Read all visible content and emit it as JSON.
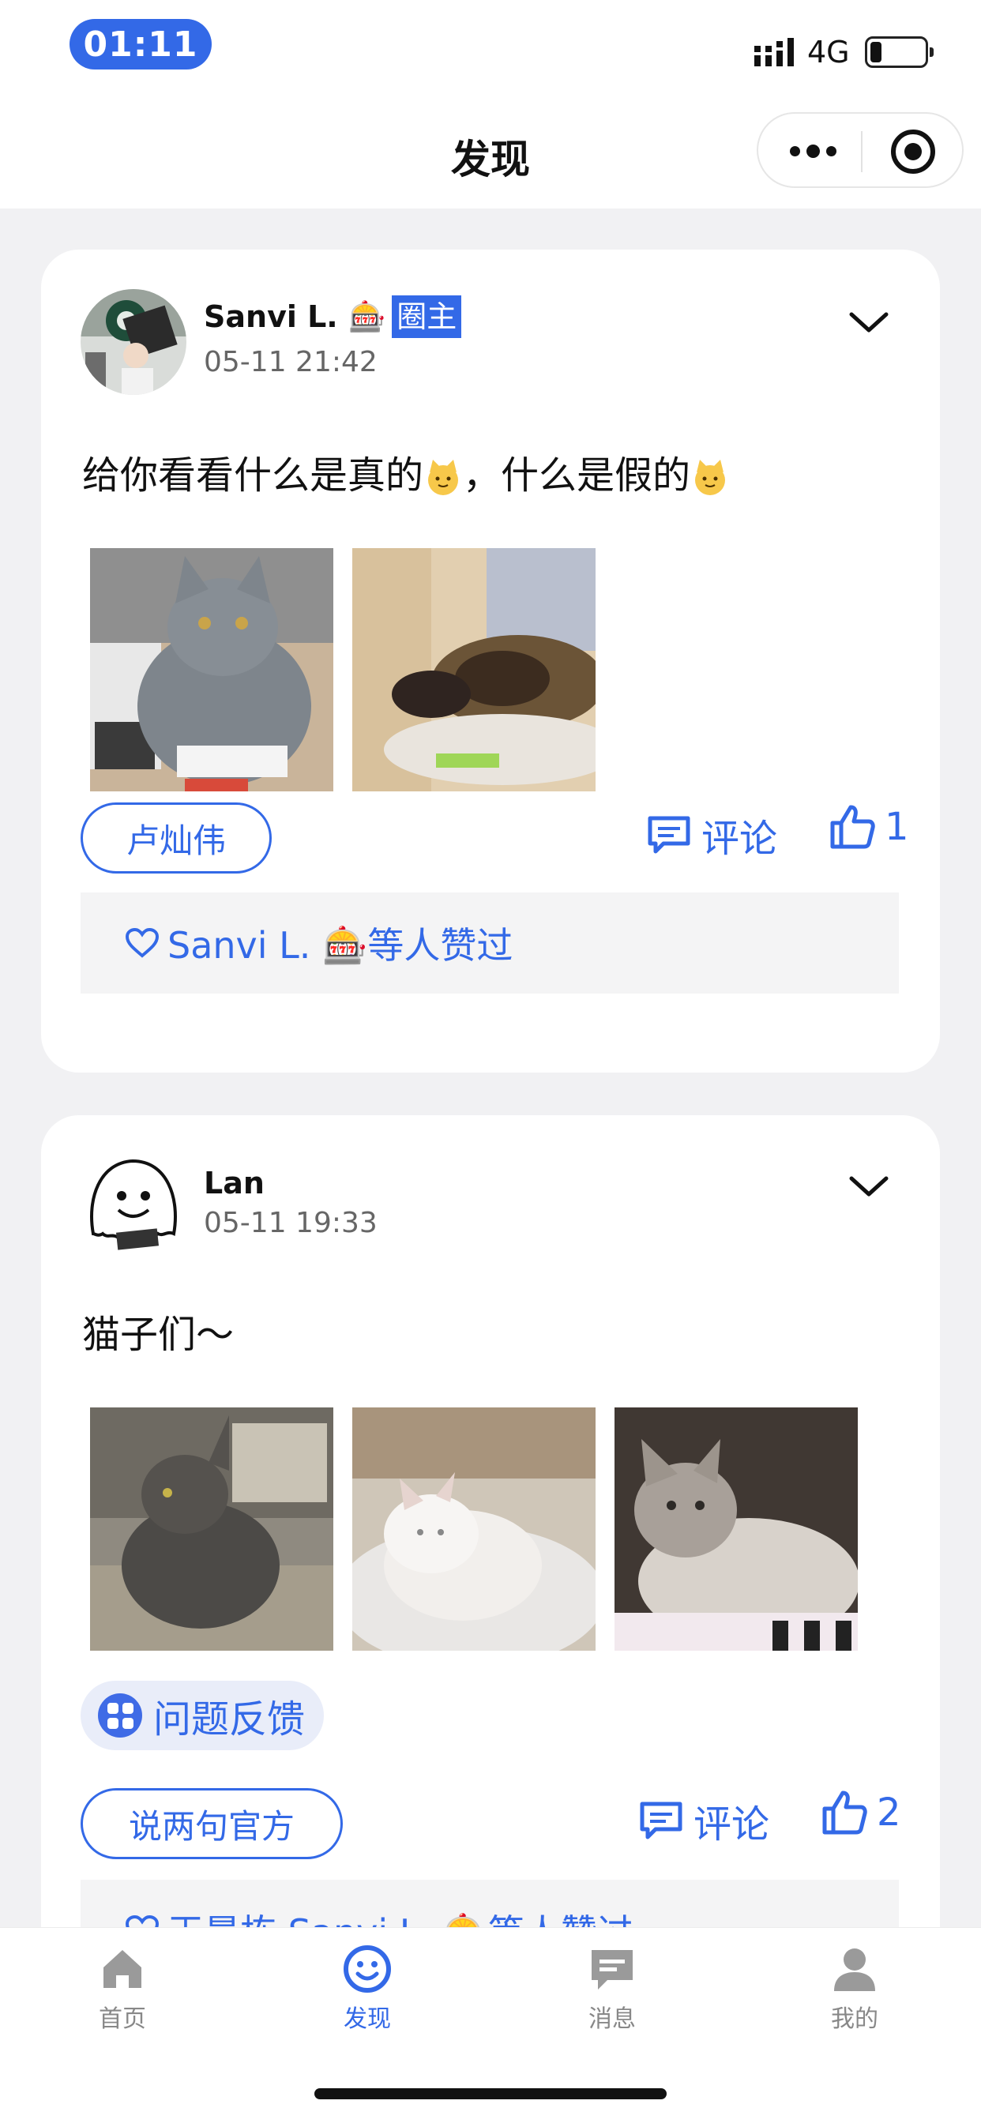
{
  "status_bar": {
    "time": "01:11",
    "network": "4G"
  },
  "nav": {
    "title": "发现"
  },
  "posts": [
    {
      "author": "Sanvi L. 🎰",
      "badge": "圈主",
      "time": "05-11 21:42",
      "text_parts": [
        "给你看看什么是真的",
        "，什么是假的"
      ],
      "images": [
        {
          "alt": "grey british shorthair cat on desk"
        },
        {
          "alt": "tortoiseshell cat sleeping"
        }
      ],
      "tag": "卢灿伟",
      "comment_label": "评论",
      "like_count": "1",
      "likes_text": "Sanvi L. 🎰等人赞过"
    },
    {
      "author": "Lan",
      "time": "05-11 19:33",
      "text": "猫子们～",
      "images": [
        {
          "alt": "grey cat sitting on floor"
        },
        {
          "alt": "white kitten sleeping"
        },
        {
          "alt": "siamese kittens"
        }
      ],
      "feedback_chip": "问题反馈",
      "tag": "说两句官方",
      "comment_label": "评论",
      "like_count": "2",
      "likes_text": "王晨栋 Sanvi L. 🎰等人赞过"
    }
  ],
  "tabs": [
    {
      "label": "首页",
      "icon": "home-icon"
    },
    {
      "label": "发现",
      "icon": "smile-icon"
    },
    {
      "label": "消息",
      "icon": "message-icon"
    },
    {
      "label": "我的",
      "icon": "user-icon"
    }
  ],
  "colors": {
    "accent": "#3369e7",
    "background": "#f1f1f3"
  }
}
